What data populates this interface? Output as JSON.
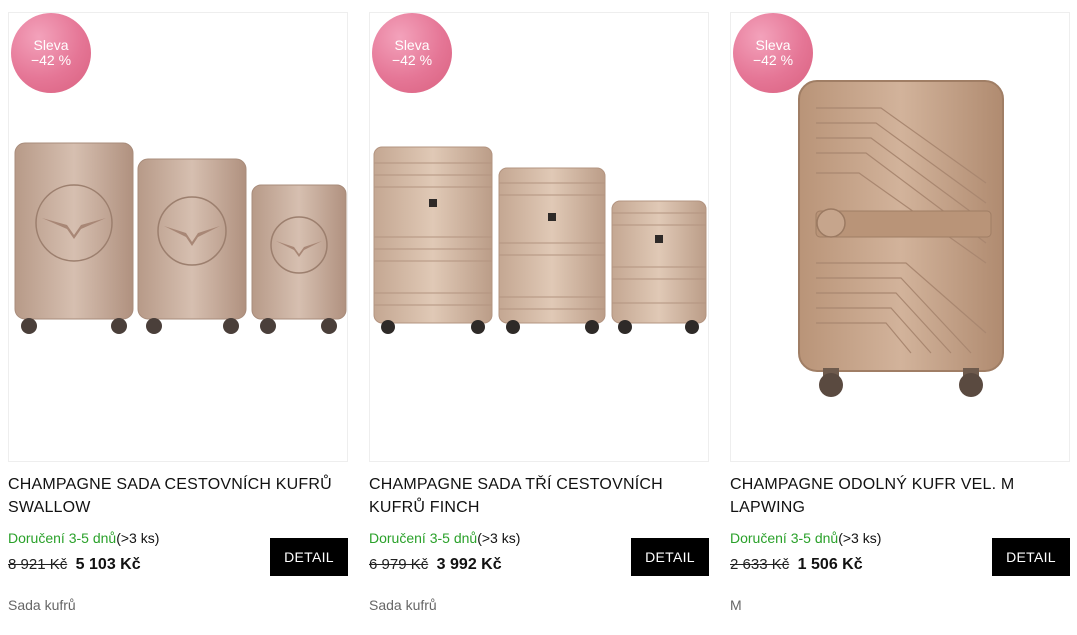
{
  "products": [
    {
      "badge_line1": "Sleva",
      "badge_line2": "−42 %",
      "title": "CHAMPAGNE SADA CESTOVNÍCH KUFRŮ SWALLOW",
      "delivery_label": "Doručení 3-5 dnů",
      "stock": "(>3 ks)",
      "old_price": "8 921 Kč",
      "new_price": "5 103 Kč",
      "detail_label": "DETAIL",
      "category": "Sada kufrů",
      "image_icon": "luggage-set-icon"
    },
    {
      "badge_line1": "Sleva",
      "badge_line2": "−42 %",
      "title": "CHAMPAGNE SADA TŘÍ CESTOVNÍCH KUFRŮ FINCH",
      "delivery_label": "Doručení 3-5 dnů",
      "stock": "(>3 ks)",
      "old_price": "6 979 Kč",
      "new_price": "3 992 Kč",
      "detail_label": "DETAIL",
      "category": "Sada kufrů",
      "image_icon": "luggage-set-icon"
    },
    {
      "badge_line1": "Sleva",
      "badge_line2": "−42 %",
      "title": "CHAMPAGNE ODOLNÝ KUFR VEL. M LAPWING",
      "delivery_label": "Doručení 3-5 dnů",
      "stock": "(>3 ks)",
      "old_price": "2 633 Kč",
      "new_price": "1 506 Kč",
      "detail_label": "DETAIL",
      "category": "M",
      "image_icon": "suitcase-icon"
    }
  ],
  "colors": {
    "badge": "#e2708f",
    "delivery_green": "#2aa12a",
    "luggage": "#c9a58a",
    "button_bg": "#000000"
  }
}
